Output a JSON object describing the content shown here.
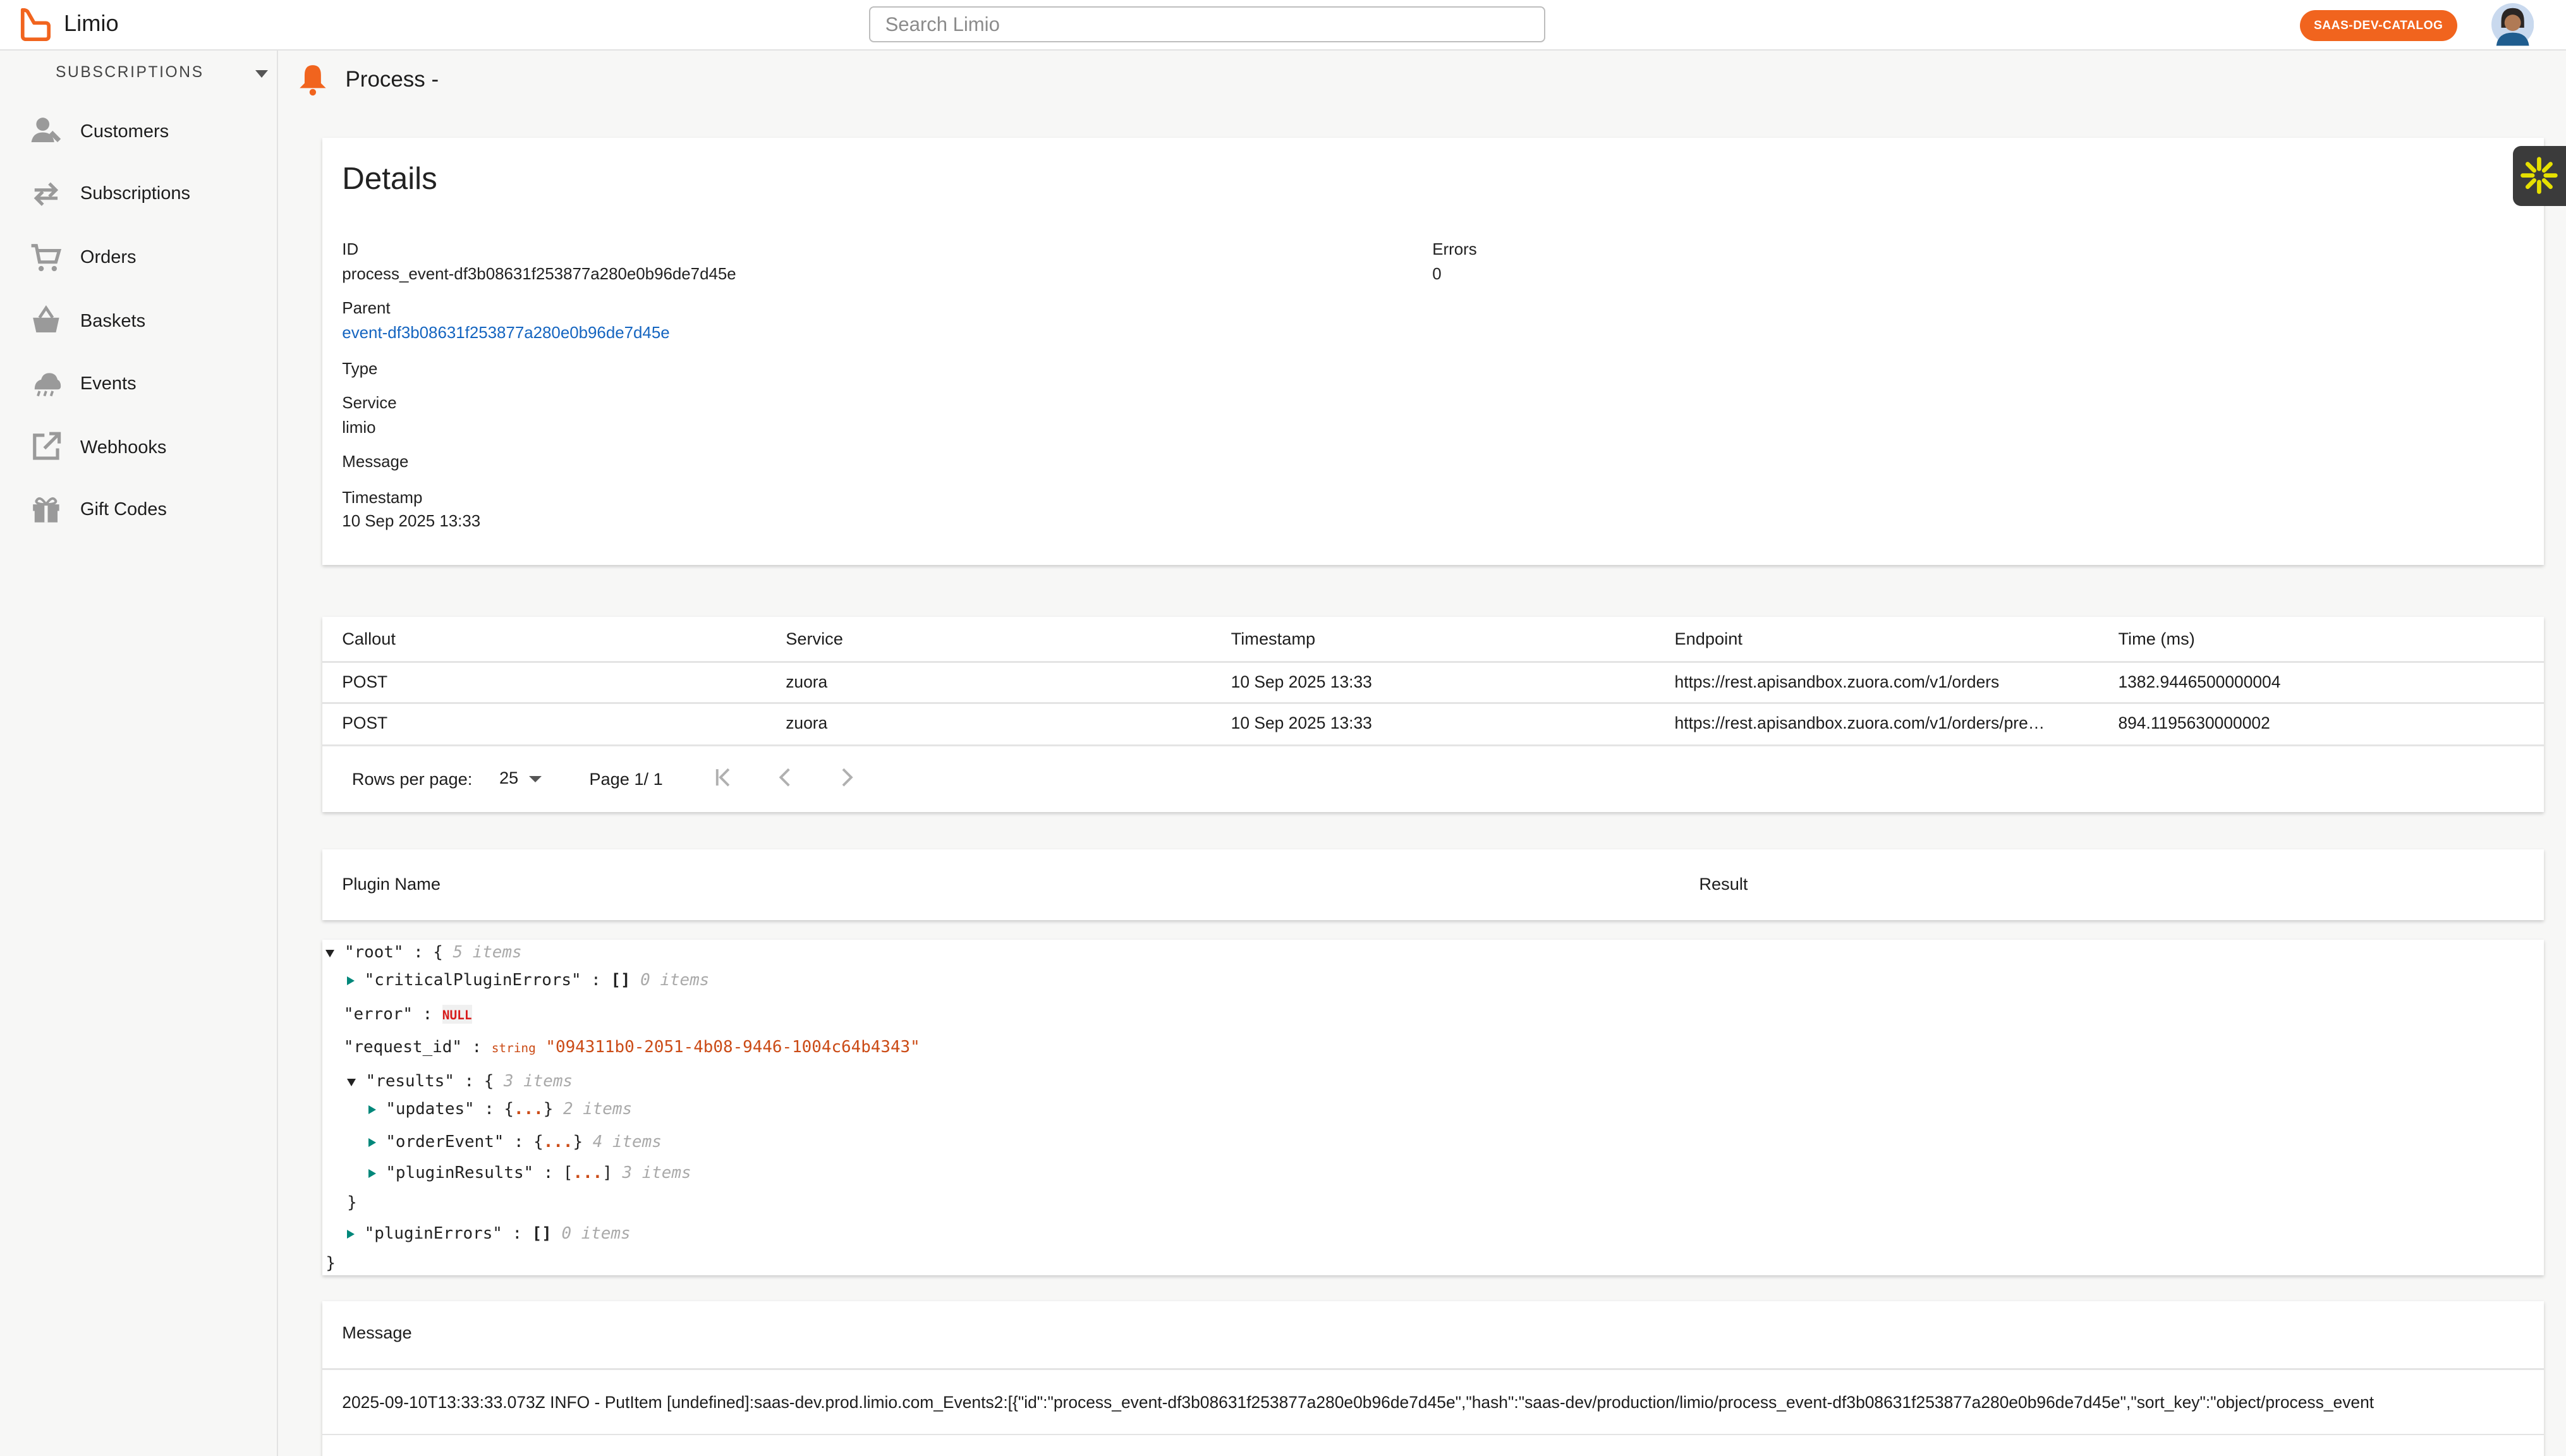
{
  "app": {
    "name": "Limio",
    "search_placeholder": "Search Limio",
    "tenant": "SAAS-DEV-CATALOG"
  },
  "sidebar": {
    "section": "SUBSCRIPTIONS",
    "items": [
      {
        "label": "Customers",
        "icon": "customers-icon"
      },
      {
        "label": "Subscriptions",
        "icon": "subscriptions-icon"
      },
      {
        "label": "Orders",
        "icon": "cart-icon"
      },
      {
        "label": "Baskets",
        "icon": "basket-icon"
      },
      {
        "label": "Events",
        "icon": "events-icon"
      },
      {
        "label": "Webhooks",
        "icon": "webhook-icon"
      },
      {
        "label": "Gift Codes",
        "icon": "gift-icon"
      }
    ]
  },
  "page": {
    "title": "Process -"
  },
  "details": {
    "title": "Details",
    "id_label": "ID",
    "id_value": "process_event-df3b08631f253877a280e0b96de7d45e",
    "errors_label": "Errors",
    "errors_value": "0",
    "parent_label": "Parent",
    "parent_value": "event-df3b08631f253877a280e0b96de7d45e",
    "type_label": "Type",
    "service_label": "Service",
    "service_value": "limio",
    "message_label": "Message",
    "timestamp_label": "Timestamp",
    "timestamp_value": "10 Sep 2025 13:33"
  },
  "callouts": {
    "headers": [
      "Callout",
      "Service",
      "Timestamp",
      "Endpoint",
      "Time (ms)"
    ],
    "rows": [
      [
        "POST",
        "zuora",
        "10 Sep 2025 13:33",
        "https://rest.apisandbox.zuora.com/v1/orders",
        "1382.9446500000004"
      ],
      [
        "POST",
        "zuora",
        "10 Sep 2025 13:33",
        "https://rest.apisandbox.zuora.com/v1/orders/pre…",
        "894.1195630000002"
      ]
    ],
    "rows_per_page_label": "Rows per page:",
    "rows_per_page": "25",
    "page_info": "Page 1/ 1"
  },
  "plugins": {
    "headers": [
      "Plugin Name",
      "Result"
    ]
  },
  "json_tree": {
    "root_key": "\"root\"",
    "root_count": "5 items",
    "critical_key": "\"criticalPluginErrors\"",
    "critical_val": "[]",
    "critical_count": "0 items",
    "error_key": "\"error\"",
    "error_val": "NULL",
    "request_key": "\"request_id\"",
    "request_type": "string",
    "request_val": "\"094311b0-2051-4b08-9446-1004c64b4343\"",
    "results_key": "\"results\"",
    "results_count": "3 items",
    "updates_key": "\"updates\"",
    "updates_count": "2 items",
    "orderevent_key": "\"orderEvent\"",
    "orderevent_count": "4 items",
    "pluginresults_key": "\"pluginResults\"",
    "pluginresults_count": "3 items",
    "pluginerrors_key": "\"pluginErrors\"",
    "pluginerrors_val": "[]",
    "pluginerrors_count": "0 items"
  },
  "message": {
    "label": "Message",
    "text": "2025-09-10T13:33:33.073Z INFO - PutItem [undefined]:saas-dev.prod.limio.com_Events2:[{\"id\":\"process_event-df3b08631f253877a280e0b96de7d45e\",\"hash\":\"saas-dev/production/limio/process_event-df3b08631f253877a280e0b96de7d45e\",\"sort_key\":\"object/process_event"
  },
  "colors": {
    "accent": "#f1641e",
    "link": "#1565c0",
    "json_string": "#cb4b16"
  }
}
